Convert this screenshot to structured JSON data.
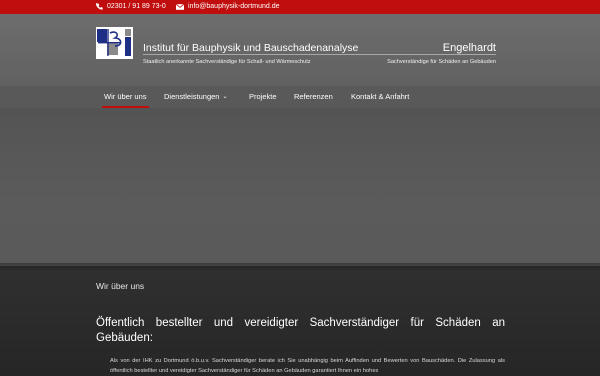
{
  "topbar": {
    "phone_icon": "phone-icon",
    "phone": "02301 / 91 89 73-0",
    "mail_icon": "envelope-icon",
    "email": "info@bauphysik-dortmund.de"
  },
  "header": {
    "institute_title": "Institut für Bauphysik und Bauschadenanalyse",
    "institute_subtitle": "Staatlich anerkannte Sachverständige für Schall- und Wärmeschutz",
    "owner_name": "Engelhardt",
    "owner_subtitle": "Sachverständige für Schäden an Gebäuden",
    "logo_colors": {
      "blue": "#1f2f86",
      "gray": "#8a8a8a"
    }
  },
  "nav": {
    "items": [
      {
        "label": "Wir über uns"
      },
      {
        "label": "Dienstleistungen"
      },
      {
        "label": "Projekte"
      },
      {
        "label": "Referenzen"
      },
      {
        "label": "Kontakt & Anfahrt"
      }
    ],
    "active_index": 0,
    "accent_color": "#c00d0d"
  },
  "main": {
    "section_label": "Wir über uns",
    "headline": "Öffentlich bestellter und vereidigter Sachverständiger für Schäden an Gebäuden:",
    "paragraph": "Als von der IHK zu Dortmund ö.b.u.v. Sachverständiger berate ich Sie unabhängig beim Auffinden und Bewerten von Bauschäden. Die Zulassung als öffentlich bestellter und vereidigter Sachverständiger für Schäden an Gebäuden garantiert Ihnen ein hohes"
  }
}
